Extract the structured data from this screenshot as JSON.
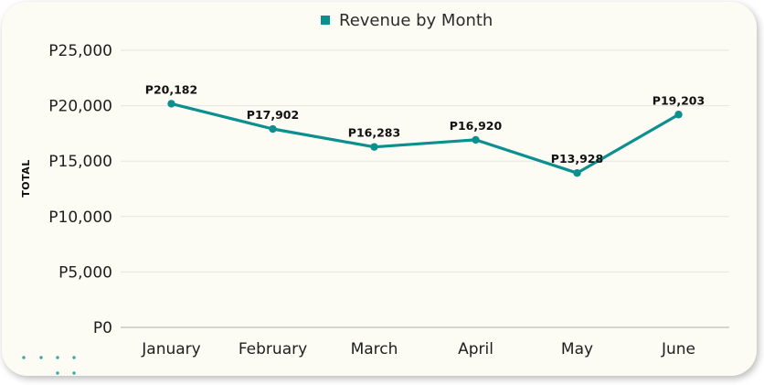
{
  "chart_data": {
    "type": "line",
    "title": "",
    "xlabel": "",
    "ylabel": "TOTAL",
    "categories": [
      "January",
      "February",
      "March",
      "April",
      "May",
      "June"
    ],
    "series": [
      {
        "name": "Revenue by Month",
        "values": [
          20182,
          17902,
          16283,
          16920,
          13928,
          19203
        ],
        "data_labels": [
          "P20,182",
          "P17,902",
          "P16,283",
          "P16,920",
          "P13,928",
          "P19,203"
        ],
        "color": "#0b8f8f"
      }
    ],
    "ylim": [
      0,
      25000
    ],
    "yticks": [
      0,
      5000,
      10000,
      15000,
      20000,
      25000
    ],
    "ytick_labels": [
      "P0",
      "P5,000",
      "P10,000",
      "P15,000",
      "P20,000",
      "P25,000"
    ],
    "grid": true,
    "legend": "top-center"
  },
  "colors": {
    "accent": "#0b8f8f",
    "background": "#fcfcf5"
  }
}
